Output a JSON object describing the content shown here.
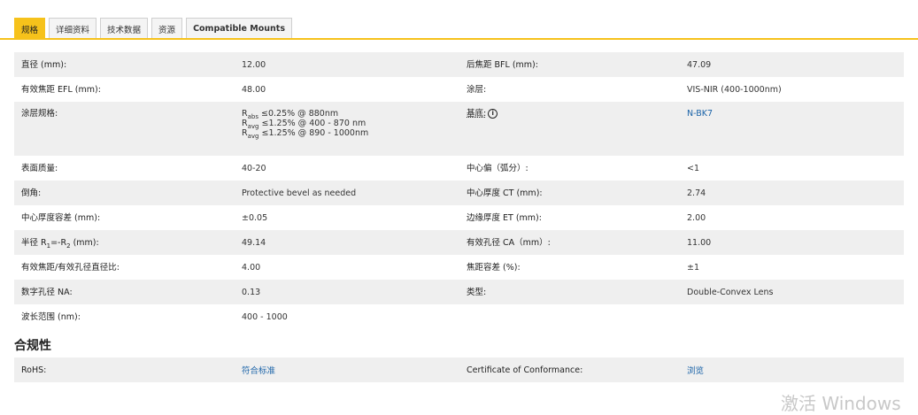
{
  "tabs": [
    {
      "label": "规格",
      "active": true
    },
    {
      "label": "详细资料",
      "active": false
    },
    {
      "label": "技术数据",
      "active": false
    },
    {
      "label": "资源",
      "active": false
    },
    {
      "label": "Compatible Mounts",
      "active": false
    }
  ],
  "specs": {
    "diameter": {
      "label": "直径 (mm):",
      "value": "12.00"
    },
    "bfl": {
      "label": "后焦距 BFL (mm):",
      "value": "47.09"
    },
    "efl": {
      "label": "有效焦距 EFL (mm):",
      "value": "48.00"
    },
    "coating": {
      "label": "涂层:",
      "value": "VIS-NIR (400-1000nm)"
    },
    "coating_spec": {
      "label": "涂层规格:",
      "lines": [
        {
          "prefix": "R",
          "sub": "abs",
          "text": " ≤0.25% @ 880nm"
        },
        {
          "prefix": "R",
          "sub": "avg",
          "text": " ≤1.25% @ 400 - 870 nm"
        },
        {
          "prefix": "R",
          "sub": "avg",
          "text": " ≤1.25% @ 890 - 1000nm"
        }
      ]
    },
    "substrate": {
      "label": "基底:",
      "value": "N-BK7"
    },
    "surface_quality": {
      "label": "表面质量:",
      "value": "40-20"
    },
    "centering": {
      "label": "中心偏（弧分）:",
      "value": "<1"
    },
    "bevel": {
      "label": "倒角:",
      "value": "Protective bevel as needed"
    },
    "ct": {
      "label": "中心厚度 CT (mm):",
      "value": "2.74"
    },
    "ct_tol": {
      "label": "中心厚度容差 (mm):",
      "value": "±0.05"
    },
    "et": {
      "label": "边缘厚度 ET (mm):",
      "value": "2.00"
    },
    "radius": {
      "label_prefix": "半径 R",
      "sub1": "1",
      "label_mid": "=-R",
      "sub2": "2",
      "label_suffix": " (mm):",
      "value": "49.14"
    },
    "ca": {
      "label": "有效孔径 CA（mm）:",
      "value": "11.00"
    },
    "f_number": {
      "label": "有效焦距/有效孔径直径比:",
      "value": "4.00"
    },
    "fl_tol": {
      "label": "焦距容差 (%):",
      "value": "±1"
    },
    "na": {
      "label": "数字孔径 NA:",
      "value": "0.13"
    },
    "type": {
      "label": "类型:",
      "value": "Double-Convex Lens"
    },
    "wavelength": {
      "label": "波长范围 (nm):",
      "value": "400 - 1000"
    }
  },
  "compliance": {
    "title": "合规性",
    "rohs_label": "RoHS:",
    "rohs_value": "符合标准",
    "coc_label": "Certificate of Conformance:",
    "coc_value": "浏览"
  },
  "watermark": "激活 Windows",
  "colors": {
    "accent": "#f6c21b",
    "link": "#1a63a8",
    "row_shade": "#efefef"
  }
}
